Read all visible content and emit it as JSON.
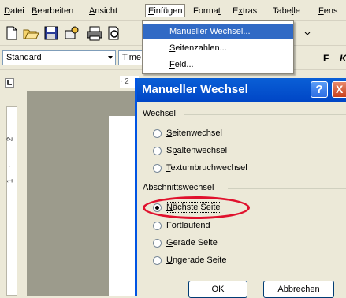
{
  "menubar": {
    "items": [
      {
        "label": "Datei",
        "mn": "D"
      },
      {
        "label": "Bearbeiten",
        "mn": "B"
      },
      {
        "label": "Ansicht",
        "mn": "A"
      },
      {
        "label": "Einfügen",
        "mn": "E"
      },
      {
        "label": "Format",
        "mn": "t"
      },
      {
        "label": "Extras",
        "mn": "x"
      },
      {
        "label": "Tabelle",
        "mn": "l"
      },
      {
        "label": "Fens",
        "mn": "F"
      }
    ]
  },
  "toolbar": {
    "style_combo": "Standard",
    "font_combo": "Time",
    "bold_label": "F",
    "italic_label": "K"
  },
  "ruler": {
    "h_mark": "· 2",
    "v_marks": [
      "2",
      "1"
    ]
  },
  "dropdown": {
    "items": [
      {
        "pre": "Manueller ",
        "mn": "W",
        "post": "echsel...",
        "selected": true
      },
      {
        "pre": "",
        "mn": "S",
        "post": "eitenzahlen...",
        "selected": false
      },
      {
        "pre": "",
        "mn": "F",
        "post": "eld...",
        "selected": false
      }
    ]
  },
  "dialog": {
    "title": "Manueller Wechsel",
    "help_label": "?",
    "close_label": "X",
    "group1": "Wechsel",
    "group2": "Abschnittswechsel",
    "options": [
      {
        "pre": "",
        "mn": "S",
        "post": "eitenwechsel",
        "checked": false
      },
      {
        "pre": "S",
        "mn": "p",
        "post": "altenwechsel",
        "checked": false
      },
      {
        "pre": "",
        "mn": "T",
        "post": "extumbruchwechsel",
        "checked": false
      },
      {
        "pre": "",
        "mn": "N",
        "post": "ächste Seite",
        "checked": true
      },
      {
        "pre": "",
        "mn": "F",
        "post": "ortlaufend",
        "checked": false
      },
      {
        "pre": "",
        "mn": "G",
        "post": "erade Seite",
        "checked": false
      },
      {
        "pre": "",
        "mn": "U",
        "post": "ngerade Seite",
        "checked": false
      }
    ],
    "ok_label": "OK",
    "cancel_label": "Abbrechen"
  },
  "colors": {
    "titlebar": "#0a5fd6",
    "highlight": "#e0112d",
    "menu_selection": "#316ac5"
  }
}
